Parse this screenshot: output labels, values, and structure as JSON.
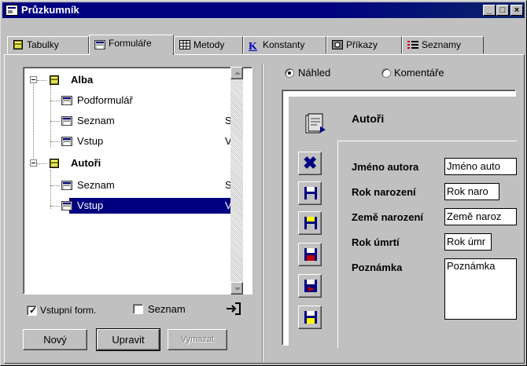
{
  "window": {
    "title": "Průzkumník",
    "controls": [
      "_",
      "□",
      "×"
    ]
  },
  "tabs": [
    {
      "label": "Tabulky",
      "icon": "table-icon",
      "active": false
    },
    {
      "label": "Formuláře",
      "icon": "form-icon",
      "active": true
    },
    {
      "label": "Metody",
      "icon": "grid-icon",
      "active": false
    },
    {
      "label": "Konstanty",
      "icon": "k-letter-icon",
      "active": false
    },
    {
      "label": "Příkazy",
      "icon": "command-icon",
      "active": false
    },
    {
      "label": "Seznamy",
      "icon": "list-icon",
      "active": false
    }
  ],
  "tree": {
    "items": [
      {
        "label": "Alba",
        "level": 0,
        "bold": true,
        "col2": "",
        "selected": false
      },
      {
        "label": "Podformulář",
        "level": 1,
        "bold": false,
        "col2": "",
        "selected": false
      },
      {
        "label": "Seznam",
        "level": 1,
        "bold": false,
        "col2": "S",
        "selected": false
      },
      {
        "label": "Vstup",
        "level": 1,
        "bold": false,
        "col2": "V",
        "selected": false
      },
      {
        "label": "Autoři",
        "level": 0,
        "bold": true,
        "col2": "",
        "selected": false
      },
      {
        "label": "Seznam",
        "level": 1,
        "bold": false,
        "col2": "S",
        "selected": false
      },
      {
        "label": "Vstup",
        "level": 1,
        "bold": false,
        "col2": "V",
        "selected": true
      }
    ]
  },
  "checkboxes": {
    "vstupni_label": "Vstupní form.",
    "vstupni_checked": true,
    "seznam_label": "Seznam",
    "seznam_checked": false
  },
  "buttons": {
    "new_label": "Nový",
    "edit_label": "Upravit",
    "delete_label": "Vymazat"
  },
  "view_mode": {
    "preview_label": "Náhled",
    "preview_selected": true,
    "comments_label": "Komentáře"
  },
  "preview": {
    "form_title": "Autoři",
    "fields": [
      {
        "label": "Jméno autora",
        "value": "Jméno auto"
      },
      {
        "label": "Rok narození",
        "value": "Rok naro"
      },
      {
        "label": "Země narození",
        "value": "Země naroz"
      },
      {
        "label": "Rok úmrtí",
        "value": "Rok úmr"
      },
      {
        "label": "Poznámka",
        "value": "Poznámka"
      }
    ]
  },
  "colors": {
    "titlebar": "#000080",
    "selection": "#000080",
    "face": "#c0c0c0"
  }
}
